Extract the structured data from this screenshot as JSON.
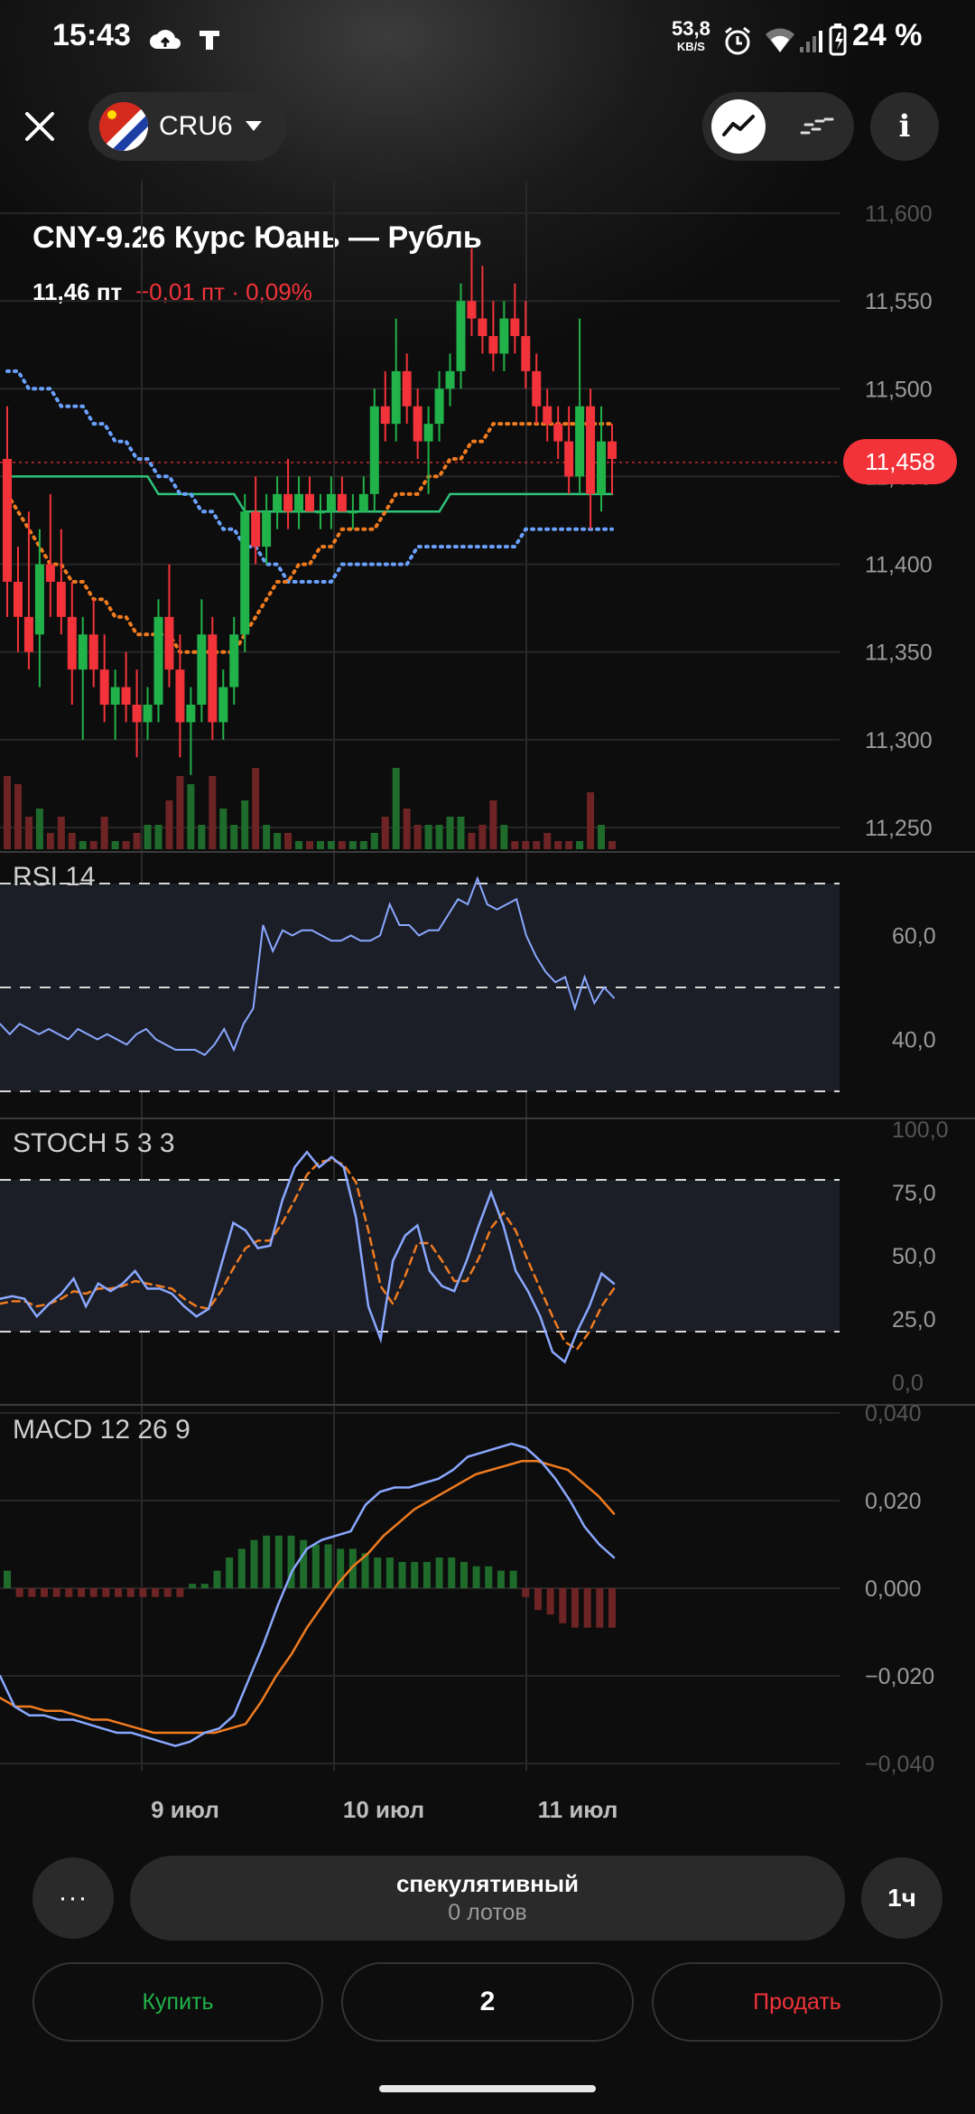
{
  "status_bar": {
    "time": "15:43",
    "net_speed": "53,8",
    "net_unit": "KB/S",
    "battery": "24 %"
  },
  "top_bar": {
    "ticker": "CRU6",
    "icons": [
      "close-icon",
      "flag-icon",
      "chevron-down-icon",
      "line-chart-icon",
      "candles-icon",
      "info-icon"
    ]
  },
  "instrument": {
    "title": "CNY-9.26 Курс Юань — Рубль",
    "price": "11,46 пт",
    "change": "−0,01 пт · 0,09%",
    "current_price_label": "11,458"
  },
  "colors": {
    "up": "#21b24a",
    "down": "#f2333a",
    "ma_fast": "#f07b1f",
    "ma_slow": "#6aa1ff",
    "ma_mid": "#2fc27a"
  },
  "chart_data": [
    {
      "type": "candlestick",
      "y_ticks": [
        "11,600",
        "11,550",
        "11,500",
        "11,450",
        "11,400",
        "11,350",
        "11,300",
        "11,250"
      ],
      "ylim": [
        11.25,
        11.6
      ],
      "x_labels": [
        "9 июл",
        "10 июл",
        "11 июл"
      ],
      "last_price": 11.458,
      "candles": [
        [
          11.46,
          11.49,
          11.37,
          11.39
        ],
        [
          11.39,
          11.41,
          11.35,
          11.37
        ],
        [
          11.37,
          11.43,
          11.34,
          11.35
        ],
        [
          11.36,
          11.42,
          11.33,
          11.4
        ],
        [
          11.4,
          11.44,
          11.37,
          11.39
        ],
        [
          11.39,
          11.42,
          11.36,
          11.37
        ],
        [
          11.37,
          11.39,
          11.32,
          11.34
        ],
        [
          11.34,
          11.37,
          11.3,
          11.36
        ],
        [
          11.36,
          11.38,
          11.33,
          11.34
        ],
        [
          11.34,
          11.36,
          11.31,
          11.32
        ],
        [
          11.32,
          11.34,
          11.3,
          11.33
        ],
        [
          11.33,
          11.35,
          11.31,
          11.32
        ],
        [
          11.32,
          11.34,
          11.29,
          11.31
        ],
        [
          11.31,
          11.33,
          11.3,
          11.32
        ],
        [
          11.32,
          11.38,
          11.31,
          11.37
        ],
        [
          11.37,
          11.4,
          11.33,
          11.34
        ],
        [
          11.34,
          11.36,
          11.29,
          11.31
        ],
        [
          11.31,
          11.33,
          11.28,
          11.32
        ],
        [
          11.32,
          11.38,
          11.31,
          11.36
        ],
        [
          11.36,
          11.37,
          11.3,
          11.31
        ],
        [
          11.31,
          11.34,
          11.3,
          11.33
        ],
        [
          11.33,
          11.37,
          11.32,
          11.36
        ],
        [
          11.36,
          11.44,
          11.35,
          11.43
        ],
        [
          11.43,
          11.45,
          11.4,
          11.41
        ],
        [
          11.41,
          11.44,
          11.4,
          11.43
        ],
        [
          11.43,
          11.45,
          11.42,
          11.44
        ],
        [
          11.44,
          11.46,
          11.42,
          11.43
        ],
        [
          11.43,
          11.45,
          11.42,
          11.44
        ],
        [
          11.44,
          11.45,
          11.43,
          11.43
        ],
        [
          11.43,
          11.44,
          11.42,
          11.43
        ],
        [
          11.43,
          11.45,
          11.42,
          11.44
        ],
        [
          11.44,
          11.45,
          11.43,
          11.43
        ],
        [
          11.43,
          11.44,
          11.42,
          11.43
        ],
        [
          11.43,
          11.45,
          11.43,
          11.44
        ],
        [
          11.44,
          11.5,
          11.43,
          11.49
        ],
        [
          11.49,
          11.51,
          11.47,
          11.48
        ],
        [
          11.48,
          11.54,
          11.47,
          11.51
        ],
        [
          11.51,
          11.52,
          11.48,
          11.49
        ],
        [
          11.49,
          11.5,
          11.46,
          11.47
        ],
        [
          11.47,
          11.49,
          11.44,
          11.48
        ],
        [
          11.48,
          11.51,
          11.47,
          11.5
        ],
        [
          11.5,
          11.52,
          11.49,
          11.51
        ],
        [
          11.51,
          11.56,
          11.5,
          11.55
        ],
        [
          11.55,
          11.58,
          11.53,
          11.54
        ],
        [
          11.54,
          11.57,
          11.52,
          11.53
        ],
        [
          11.53,
          11.55,
          11.51,
          11.52
        ],
        [
          11.52,
          11.55,
          11.51,
          11.54
        ],
        [
          11.54,
          11.56,
          11.52,
          11.53
        ],
        [
          11.53,
          11.55,
          11.5,
          11.51
        ],
        [
          11.51,
          11.52,
          11.48,
          11.49
        ],
        [
          11.49,
          11.5,
          11.47,
          11.48
        ],
        [
          11.48,
          11.49,
          11.46,
          11.47
        ],
        [
          11.47,
          11.49,
          11.44,
          11.45
        ],
        [
          11.45,
          11.54,
          11.44,
          11.49
        ],
        [
          11.49,
          11.5,
          11.42,
          11.44
        ],
        [
          11.44,
          11.49,
          11.43,
          11.47
        ],
        [
          11.47,
          11.48,
          11.44,
          11.46
        ]
      ],
      "ma_fast": [
        11.44,
        11.43,
        11.42,
        11.41,
        11.4,
        11.4,
        11.39,
        11.39,
        11.38,
        11.38,
        11.37,
        11.37,
        11.36,
        11.36,
        11.36,
        11.36,
        11.35,
        11.35,
        11.35,
        11.35,
        11.35,
        11.35,
        11.36,
        11.37,
        11.38,
        11.39,
        11.39,
        11.4,
        11.4,
        11.41,
        11.41,
        11.42,
        11.42,
        11.42,
        11.42,
        11.43,
        11.44,
        11.44,
        11.44,
        11.45,
        11.45,
        11.46,
        11.46,
        11.47,
        11.47,
        11.48,
        11.48,
        11.48,
        11.48,
        11.48,
        11.48,
        11.48,
        11.48,
        11.48,
        11.48,
        11.48,
        11.48
      ],
      "ma_slow": [
        11.51,
        11.51,
        11.5,
        11.5,
        11.5,
        11.49,
        11.49,
        11.49,
        11.48,
        11.48,
        11.47,
        11.47,
        11.46,
        11.46,
        11.45,
        11.45,
        11.44,
        11.44,
        11.43,
        11.43,
        11.42,
        11.42,
        11.41,
        11.41,
        11.4,
        11.4,
        11.39,
        11.39,
        11.39,
        11.39,
        11.39,
        11.4,
        11.4,
        11.4,
        11.4,
        11.4,
        11.4,
        11.4,
        11.41,
        11.41,
        11.41,
        11.41,
        11.41,
        11.41,
        11.41,
        11.41,
        11.41,
        11.41,
        11.42,
        11.42,
        11.42,
        11.42,
        11.42,
        11.42,
        11.42,
        11.42,
        11.42
      ],
      "ma_mid": [
        11.45,
        11.45,
        11.45,
        11.45,
        11.45,
        11.45,
        11.45,
        11.45,
        11.45,
        11.45,
        11.45,
        11.45,
        11.45,
        11.45,
        11.44,
        11.44,
        11.44,
        11.44,
        11.44,
        11.44,
        11.44,
        11.44,
        11.43,
        11.43,
        11.43,
        11.43,
        11.43,
        11.43,
        11.43,
        11.43,
        11.43,
        11.43,
        11.43,
        11.43,
        11.43,
        11.43,
        11.43,
        11.43,
        11.43,
        11.43,
        11.43,
        11.44,
        11.44,
        11.44,
        11.44,
        11.44,
        11.44,
        11.44,
        11.44,
        11.44,
        11.44,
        11.44,
        11.44,
        11.44,
        11.44,
        11.44,
        11.44
      ],
      "volume": [
        0.9,
        0.8,
        0.4,
        0.5,
        0.2,
        0.4,
        0.2,
        0.1,
        0.1,
        0.4,
        0.1,
        0.1,
        0.2,
        0.3,
        0.3,
        0.6,
        0.9,
        0.8,
        0.3,
        0.9,
        0.5,
        0.3,
        0.6,
        1.0,
        0.3,
        0.2,
        0.2,
        0.1,
        0.1,
        0.1,
        0.1,
        0.1,
        0.1,
        0.1,
        0.2,
        0.4,
        1.0,
        0.5,
        0.3,
        0.3,
        0.3,
        0.4,
        0.4,
        0.2,
        0.3,
        0.6,
        0.3,
        0.1,
        0.1,
        0.1,
        0.2,
        0.1,
        0.1,
        0.1,
        0.7,
        0.3,
        0.1
      ]
    },
    {
      "type": "line",
      "title": "RSI 14",
      "y_ticks": [
        "60,0",
        "40,0"
      ],
      "ylim": [
        30,
        75
      ],
      "levels": [
        70,
        50,
        30
      ],
      "values": [
        43,
        41,
        43,
        42,
        41,
        42,
        41,
        40,
        42,
        41,
        40,
        41,
        40,
        39,
        41,
        42,
        40,
        39,
        38,
        38,
        38,
        37,
        39,
        42,
        38,
        43,
        46,
        62,
        57,
        61,
        60,
        61,
        61,
        60,
        59,
        59,
        60,
        59,
        59,
        60,
        66,
        62,
        62,
        60,
        61,
        61,
        64,
        67,
        66,
        71,
        66,
        65,
        66,
        67,
        60,
        56,
        53,
        51,
        52,
        46,
        52,
        47,
        50,
        48
      ],
      "color": "#8aa8ff"
    },
    {
      "type": "line",
      "title": "STOCH 5 3 3",
      "y_ticks": [
        "100,0",
        "75,0",
        "50,0",
        "25,0",
        "0,0"
      ],
      "ylim": [
        0,
        100
      ],
      "levels": [
        80,
        20
      ],
      "k": [
        33,
        34,
        33,
        26,
        31,
        35,
        41,
        30,
        39,
        36,
        39,
        44,
        37,
        37,
        35,
        30,
        26,
        29,
        46,
        63,
        60,
        53,
        54,
        72,
        85,
        91,
        85,
        89,
        85,
        65,
        30,
        17,
        48,
        58,
        62,
        44,
        38,
        36,
        48,
        62,
        75,
        62,
        44,
        36,
        26,
        12,
        8,
        20,
        30,
        43,
        39
      ],
      "d": [
        31,
        32,
        32,
        30,
        31,
        33,
        36,
        35,
        37,
        37,
        38,
        40,
        39,
        38,
        37,
        33,
        30,
        29,
        36,
        45,
        53,
        56,
        56,
        63,
        72,
        82,
        87,
        88,
        86,
        79,
        60,
        38,
        31,
        42,
        55,
        55,
        48,
        40,
        40,
        49,
        61,
        67,
        60,
        48,
        37,
        26,
        16,
        13,
        20,
        30,
        37
      ],
      "colors": {
        "k": "#8aa8ff",
        "d": "#f07b1f"
      }
    },
    {
      "type": "bar+line",
      "title": "MACD 12 26 9",
      "y_ticks": [
        "0,040",
        "0,020",
        "0,000",
        "−0,020",
        "−0,040"
      ],
      "ylim": [
        -0.04,
        0.04
      ],
      "macd": [
        -0.02,
        -0.027,
        -0.029,
        -0.029,
        -0.03,
        -0.03,
        -0.031,
        -0.032,
        -0.033,
        -0.033,
        -0.034,
        -0.035,
        -0.036,
        -0.035,
        -0.033,
        -0.032,
        -0.029,
        -0.021,
        -0.013,
        -0.004,
        0.004,
        0.009,
        0.011,
        0.012,
        0.013,
        0.019,
        0.022,
        0.023,
        0.023,
        0.024,
        0.025,
        0.027,
        0.03,
        0.031,
        0.032,
        0.033,
        0.032,
        0.029,
        0.025,
        0.02,
        0.014,
        0.01,
        0.007
      ],
      "signal": [
        -0.025,
        -0.027,
        -0.027,
        -0.028,
        -0.028,
        -0.029,
        -0.03,
        -0.03,
        -0.031,
        -0.032,
        -0.033,
        -0.033,
        -0.033,
        -0.033,
        -0.033,
        -0.032,
        -0.031,
        -0.026,
        -0.02,
        -0.015,
        -0.009,
        -0.004,
        0.001,
        0.005,
        0.008,
        0.012,
        0.015,
        0.018,
        0.02,
        0.022,
        0.024,
        0.026,
        0.027,
        0.028,
        0.029,
        0.029,
        0.028,
        0.027,
        0.024,
        0.021,
        0.017
      ],
      "histogram": [
        0.004,
        -0.002,
        -0.002,
        -0.002,
        -0.002,
        -0.002,
        -0.002,
        -0.002,
        -0.002,
        -0.002,
        -0.002,
        -0.002,
        -0.002,
        -0.002,
        -0.002,
        0.001,
        0.001,
        0.004,
        0.007,
        0.009,
        0.011,
        0.012,
        0.012,
        0.012,
        0.011,
        0.01,
        0.01,
        0.009,
        0.009,
        0.008,
        0.007,
        0.007,
        0.006,
        0.006,
        0.006,
        0.007,
        0.007,
        0.006,
        0.005,
        0.005,
        0.004,
        0.004,
        -0.002,
        -0.005,
        -0.006,
        -0.008,
        -0.009,
        -0.009,
        -0.009,
        -0.009
      ],
      "colors": {
        "macd": "#8aa8ff",
        "signal": "#f07b1f",
        "hist_up": "#1f6b2c",
        "hist_down": "#6e2424"
      }
    }
  ],
  "bottom_panel": {
    "more_label": "···",
    "strategy_title": "спекулятивный",
    "strategy_subtitle": "0 лотов",
    "interval": "1ч",
    "buy_label": "Купить",
    "quantity": "2",
    "sell_label": "Продать"
  }
}
